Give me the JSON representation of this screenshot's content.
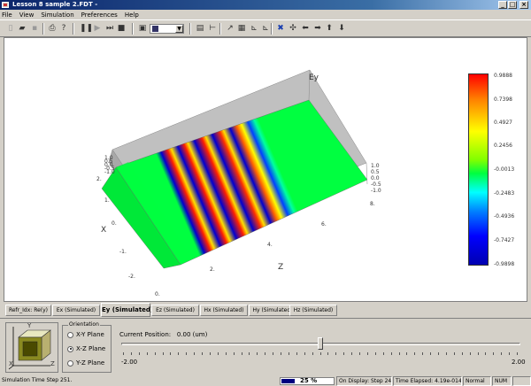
{
  "window": {
    "title": "Lesson 8 sample 2.FDT -",
    "minimize": "_",
    "maximize": "□",
    "close": "×"
  },
  "menu": [
    "File",
    "View",
    "Simulation",
    "Preferences",
    "Help"
  ],
  "plot": {
    "axis_labels": {
      "vertical": "Ey",
      "x": "X",
      "z": "Z"
    },
    "x_ticks": [
      "2.",
      "1.",
      "0.",
      "-1.",
      "-2."
    ],
    "z_ticks": [
      "0.",
      "2.",
      "4.",
      "6.",
      "8."
    ],
    "y_ticks_left": [
      "1.0",
      "0.5",
      "0.0",
      "-0.5",
      "-1.0"
    ],
    "y_ticks_right": [
      "1.0",
      "0.5",
      "0.0",
      "-0.5",
      "-1.0"
    ],
    "colorbar_ticks": [
      "0.9888",
      "0.7398",
      "0.4927",
      "0.2456",
      "-0.0013",
      "-0.2483",
      "-0.4936",
      "-0.7427",
      "-0.9898"
    ],
    "colors": {
      "max": "#ff0000",
      "mid": "#00ff40",
      "min": "#0000b0",
      "box_wall": "#c0c0c0"
    }
  },
  "tabs": [
    "Refr_Idx: Re(y)",
    "Ex (Simulated)",
    "Ey (Simulated)",
    "Ez (Simulated)",
    "Hx (Simulated)",
    "Hy (Simulated)",
    "Hz (Simulated)"
  ],
  "active_tab": "Ey (Simulated)",
  "orientation": {
    "legend": "Orientation",
    "options": [
      "X-Y Plane",
      "X-Z Plane",
      "Y-Z Plane"
    ],
    "selected": "X-Z Plane",
    "cube_axes": {
      "y": "Y",
      "x": "X",
      "z": "Z"
    }
  },
  "position": {
    "label": "Current Position:",
    "value": "0.00 (um)",
    "min": "-2.00",
    "max": "2.00",
    "fraction": 0.5
  },
  "status": {
    "message": "Simulation Time Step 251.",
    "progress_text": "25 %",
    "progress": 0.25,
    "on_display": "On Display: Step 240",
    "time_elapsed": "Time Elapsed: 4.19e-014 s",
    "mode": "Normal",
    "num": "NUM"
  }
}
